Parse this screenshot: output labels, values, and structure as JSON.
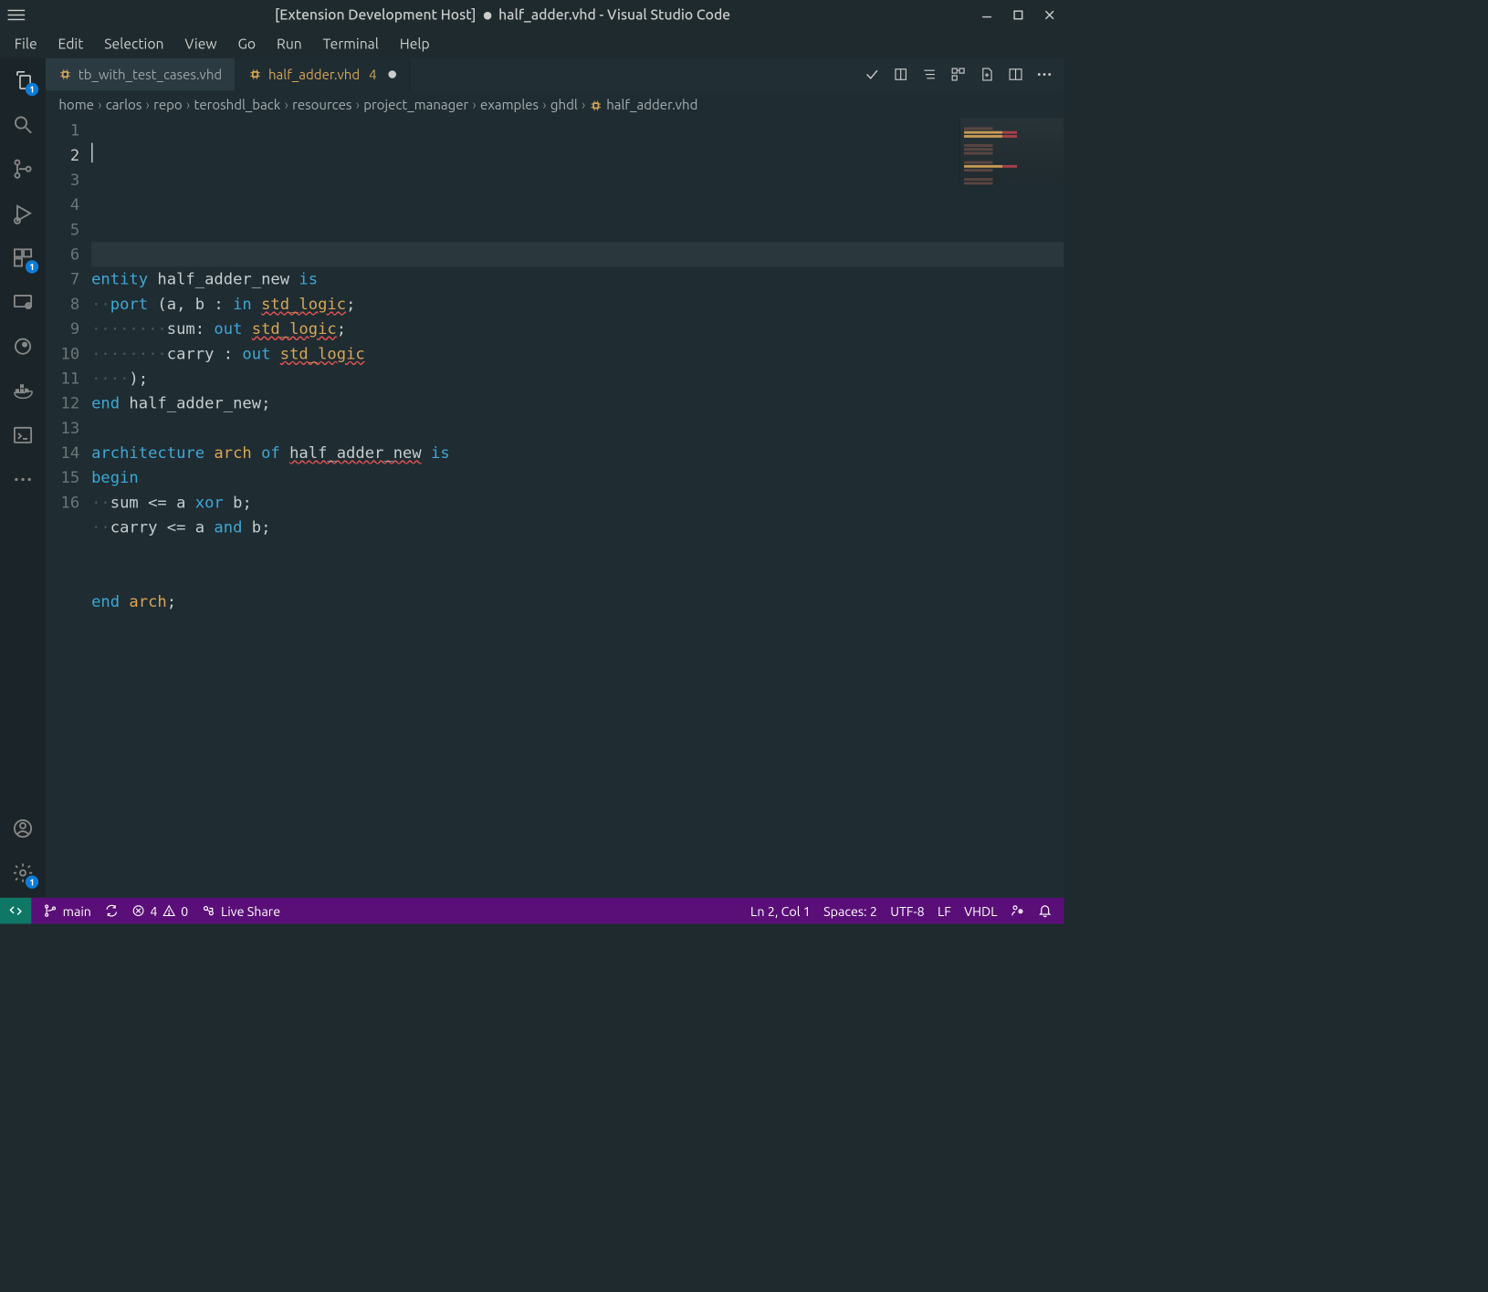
{
  "window": {
    "title_prefix": "[Extension Development Host]",
    "title_file": "half_adder.vhd",
    "title_suffix": "- Visual Studio Code"
  },
  "menubar": [
    "File",
    "Edit",
    "Selection",
    "View",
    "Go",
    "Run",
    "Terminal",
    "Help"
  ],
  "activitybar": {
    "explorer_badge": "1",
    "extensions_badge": "1",
    "gear_badge": "1"
  },
  "tabs": [
    {
      "label": "tb_with_test_cases.vhd",
      "active": false,
      "modified": false,
      "problems": ""
    },
    {
      "label": "half_adder.vhd",
      "active": true,
      "modified": true,
      "problems": "4"
    }
  ],
  "breadcrumbs": [
    "home",
    "carlos",
    "repo",
    "teroshdl_back",
    "resources",
    "project_manager",
    "examples",
    "ghdl",
    "half_adder.vhd"
  ],
  "code_lines_count": 16,
  "code_current_line": 2,
  "code_tokens": [
    [],
    [],
    [
      {
        "t": "kw",
        "s": "entity"
      },
      {
        "t": "sp",
        "s": " "
      },
      {
        "t": "id",
        "s": "half_adder_new"
      },
      {
        "t": "sp",
        "s": " "
      },
      {
        "t": "kw",
        "s": "is"
      }
    ],
    [
      {
        "t": "ws",
        "s": "··"
      },
      {
        "t": "kw",
        "s": "port"
      },
      {
        "t": "sp",
        "s": " "
      },
      {
        "t": "punct",
        "s": "("
      },
      {
        "t": "id",
        "s": "a"
      },
      {
        "t": "punct",
        "s": ","
      },
      {
        "t": "sp",
        "s": " "
      },
      {
        "t": "id",
        "s": "b"
      },
      {
        "t": "sp",
        "s": " "
      },
      {
        "t": "punct",
        "s": ":"
      },
      {
        "t": "sp",
        "s": " "
      },
      {
        "t": "kw",
        "s": "in"
      },
      {
        "t": "sp",
        "s": " "
      },
      {
        "t": "typeerr",
        "s": "std_logic"
      },
      {
        "t": "punct",
        "s": ";"
      }
    ],
    [
      {
        "t": "ws",
        "s": "········"
      },
      {
        "t": "id",
        "s": "sum"
      },
      {
        "t": "punct",
        "s": ":"
      },
      {
        "t": "sp",
        "s": " "
      },
      {
        "t": "kw",
        "s": "out"
      },
      {
        "t": "sp",
        "s": " "
      },
      {
        "t": "typeerr",
        "s": "std_logic"
      },
      {
        "t": "punct",
        "s": ";"
      }
    ],
    [
      {
        "t": "ws",
        "s": "········"
      },
      {
        "t": "id",
        "s": "carry"
      },
      {
        "t": "sp",
        "s": " "
      },
      {
        "t": "punct",
        "s": ":"
      },
      {
        "t": "sp",
        "s": " "
      },
      {
        "t": "kw",
        "s": "out"
      },
      {
        "t": "sp",
        "s": " "
      },
      {
        "t": "typeerr",
        "s": "std_logic"
      }
    ],
    [
      {
        "t": "ws",
        "s": "····"
      },
      {
        "t": "punct",
        "s": ");"
      }
    ],
    [
      {
        "t": "kw",
        "s": "end"
      },
      {
        "t": "sp",
        "s": " "
      },
      {
        "t": "id",
        "s": "half_adder_new"
      },
      {
        "t": "punct",
        "s": ";"
      }
    ],
    [],
    [
      {
        "t": "kw",
        "s": "architecture"
      },
      {
        "t": "sp",
        "s": " "
      },
      {
        "t": "type",
        "s": "arch"
      },
      {
        "t": "sp",
        "s": " "
      },
      {
        "t": "kw",
        "s": "of"
      },
      {
        "t": "sp",
        "s": " "
      },
      {
        "t": "nameerr",
        "s": "half_adder_new"
      },
      {
        "t": "sp",
        "s": " "
      },
      {
        "t": "kw",
        "s": "is"
      }
    ],
    [
      {
        "t": "begin",
        "s": "begin"
      }
    ],
    [
      {
        "t": "ws",
        "s": "··"
      },
      {
        "t": "id",
        "s": "sum"
      },
      {
        "t": "sp",
        "s": " "
      },
      {
        "t": "punct",
        "s": "<="
      },
      {
        "t": "sp",
        "s": " "
      },
      {
        "t": "id",
        "s": "a"
      },
      {
        "t": "sp",
        "s": " "
      },
      {
        "t": "kw",
        "s": "xor"
      },
      {
        "t": "sp",
        "s": " "
      },
      {
        "t": "id",
        "s": "b"
      },
      {
        "t": "punct",
        "s": ";"
      }
    ],
    [
      {
        "t": "ws",
        "s": "··"
      },
      {
        "t": "id",
        "s": "carry"
      },
      {
        "t": "sp",
        "s": " "
      },
      {
        "t": "punct",
        "s": "<="
      },
      {
        "t": "sp",
        "s": " "
      },
      {
        "t": "id",
        "s": "a"
      },
      {
        "t": "sp",
        "s": " "
      },
      {
        "t": "kw",
        "s": "and"
      },
      {
        "t": "sp",
        "s": " "
      },
      {
        "t": "id",
        "s": "b"
      },
      {
        "t": "punct",
        "s": ";"
      }
    ],
    [],
    [],
    [
      {
        "t": "kw",
        "s": "end"
      },
      {
        "t": "sp",
        "s": " "
      },
      {
        "t": "type",
        "s": "arch"
      },
      {
        "t": "punct",
        "s": ";"
      }
    ]
  ],
  "statusbar": {
    "branch": "main",
    "errors": "4",
    "warnings": "0",
    "live_share": "Live Share",
    "position": "Ln 2, Col 1",
    "spaces": "Spaces: 2",
    "encoding": "UTF-8",
    "eol": "LF",
    "language": "VHDL"
  }
}
